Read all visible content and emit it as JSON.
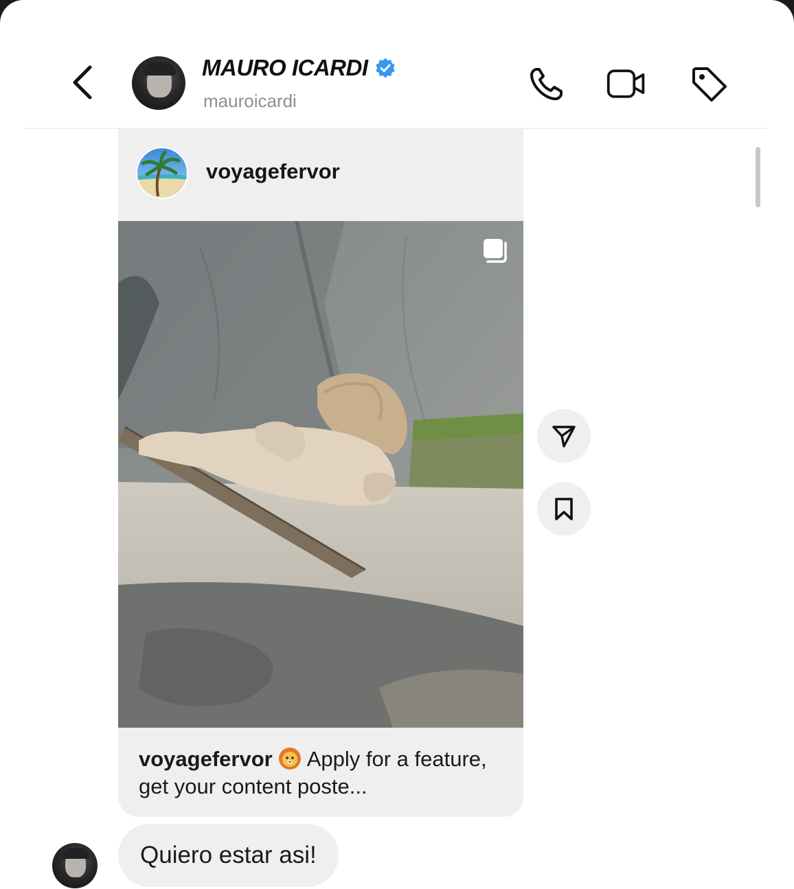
{
  "header": {
    "display_name": "MAURO ICARDI",
    "username": "mauroicardi",
    "icons": {
      "back": "chevron-left-icon",
      "verified": "verified-badge-icon",
      "call": "phone-icon",
      "video": "video-camera-icon",
      "tag": "tag-icon"
    },
    "colors": {
      "verified": "#3897f0"
    }
  },
  "shared_post": {
    "author": "voyagefervor",
    "caption_user": "voyagefervor",
    "caption_emoji": "lion-emoji",
    "caption_text": "Apply for a feature, get your content poste...",
    "media_icon": "multiple-media-icon",
    "actions": [
      {
        "name": "share",
        "icon": "paper-plane-icon"
      },
      {
        "name": "save",
        "icon": "bookmark-icon"
      }
    ]
  },
  "messages": [
    {
      "sender": "mauroicardi",
      "text": "Quiero estar asi!"
    }
  ]
}
